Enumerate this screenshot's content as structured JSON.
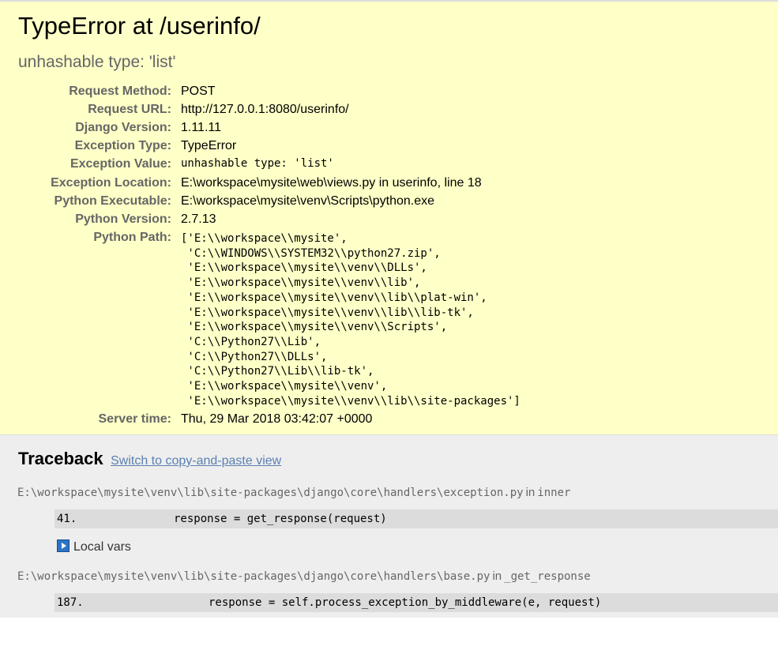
{
  "summary": {
    "title": "TypeError at /userinfo/",
    "subtitle": "unhashable type: 'list'",
    "meta": [
      {
        "key": "Request Method:",
        "value": "POST"
      },
      {
        "key": "Request URL:",
        "value": "http://127.0.0.1:8080/userinfo/"
      },
      {
        "key": "Django Version:",
        "value": "1.11.11"
      },
      {
        "key": "Exception Type:",
        "value": "TypeError"
      },
      {
        "key": "Exception Value:",
        "value": "unhashable type: 'list'"
      },
      {
        "key": "Exception Location:",
        "value": "E:\\workspace\\mysite\\web\\views.py in userinfo, line 18"
      },
      {
        "key": "Python Executable:",
        "value": "E:\\workspace\\mysite\\venv\\Scripts\\python.exe"
      },
      {
        "key": "Python Version:",
        "value": "2.7.13"
      },
      {
        "key": "Python Path:",
        "value": "['E:\\\\workspace\\\\mysite',\n 'C:\\\\WINDOWS\\\\SYSTEM32\\\\python27.zip',\n 'E:\\\\workspace\\\\mysite\\\\venv\\\\DLLs',\n 'E:\\\\workspace\\\\mysite\\\\venv\\\\lib',\n 'E:\\\\workspace\\\\mysite\\\\venv\\\\lib\\\\plat-win',\n 'E:\\\\workspace\\\\mysite\\\\venv\\\\lib\\\\lib-tk',\n 'E:\\\\workspace\\\\mysite\\\\venv\\\\Scripts',\n 'C:\\\\Python27\\\\Lib',\n 'C:\\\\Python27\\\\DLLs',\n 'C:\\\\Python27\\\\Lib\\\\lib-tk',\n 'E:\\\\workspace\\\\mysite\\\\venv',\n 'E:\\\\workspace\\\\mysite\\\\venv\\\\lib\\\\site-packages']"
      },
      {
        "key": "Server time:",
        "value": "Thu, 29 Mar 2018 03:42:07 +0000"
      }
    ]
  },
  "traceback": {
    "title": "Traceback",
    "switch_link": "Switch to copy-and-paste view",
    "local_vars_label": "Local vars",
    "local_vars_icon": "expand-triangle-icon",
    "in_word": "in",
    "frames": [
      {
        "file": "E:\\workspace\\mysite\\venv\\lib\\site-packages\\django\\core\\handlers\\exception.py",
        "function": "inner",
        "lineno": "41.",
        "code": "response = get_response(request)"
      },
      {
        "file": "E:\\workspace\\mysite\\venv\\lib\\site-packages\\django\\core\\handlers\\base.py",
        "function": "_get_response",
        "lineno": "187.",
        "code": "response = self.process_exception_by_middleware(e, request)"
      }
    ]
  },
  "colors": {
    "summary_bg": "#ffffc8",
    "traceback_bg": "#eeeeee",
    "code_bg": "#dcdcdc",
    "link": "#5b80b2"
  }
}
